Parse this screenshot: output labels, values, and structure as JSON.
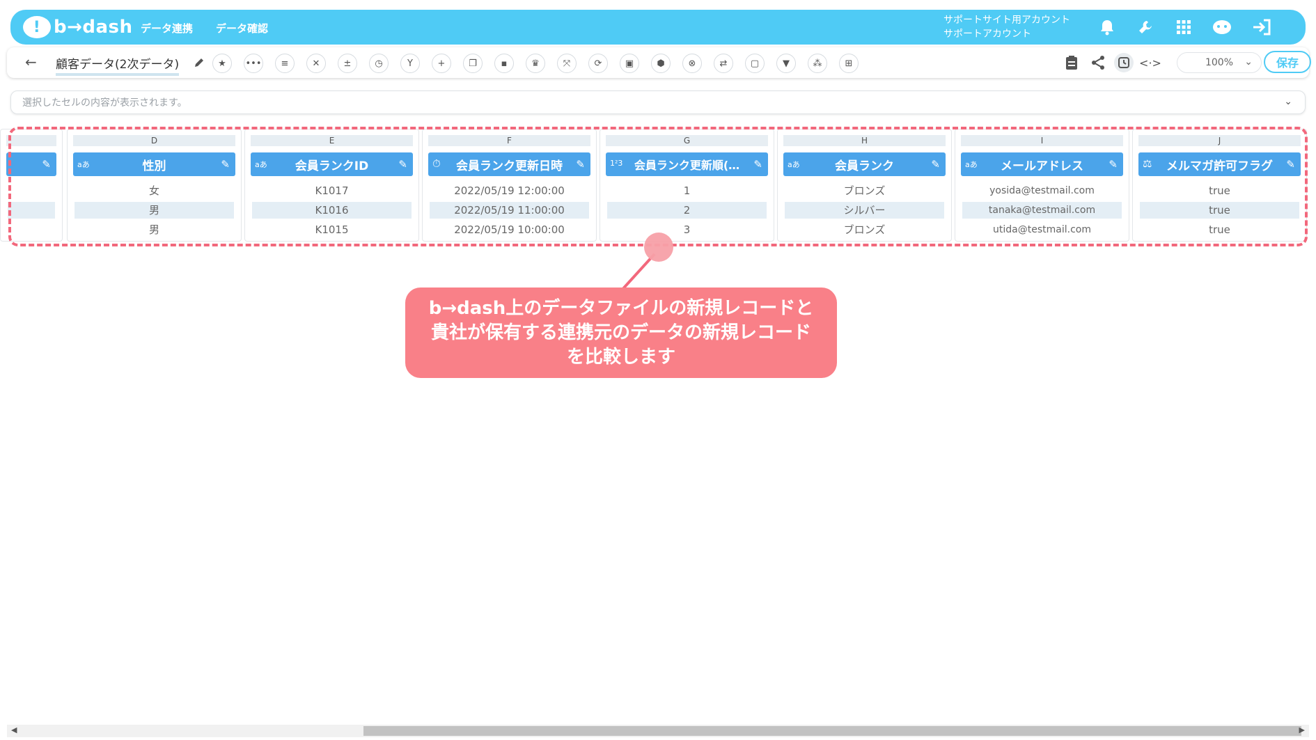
{
  "app": {
    "logo_text": "b→dash",
    "nav": [
      "データ連携",
      "データ確認"
    ],
    "account_line1": "サポートサイト用アカウント",
    "account_line2": "サポートアカウント",
    "top_icons": [
      "bell-icon",
      "wrench-icon",
      "apps-grid-icon",
      "chat-robot-icon",
      "logout-icon"
    ],
    "accent": "#4fcbf5"
  },
  "toolbar": {
    "back": "←",
    "title": "顧客データ(2次データ)",
    "tool_icons": [
      "star-icon",
      "dots-icon",
      "lines-icon",
      "tools-icon",
      "calc-icon",
      "timer-icon",
      "merge-icon",
      "plus-icon",
      "copy-icon",
      "trash-icon",
      "crown-icon",
      "expand-icon",
      "repeat-icon",
      "lock-icon",
      "box-icon",
      "cancel-icon",
      "replace-icon",
      "frame-icon",
      "filter-icon",
      "pattern-icon",
      "table-icon"
    ],
    "right_icons": [
      "clipboard-icon",
      "share-icon",
      "history-icon",
      "code-icon"
    ],
    "zoom": "100%",
    "save_label": "保存"
  },
  "cellbar": {
    "placeholder": "選択したセルの内容が表示されます。"
  },
  "columns": [
    {
      "letter": "",
      "name": "",
      "type": "",
      "cells": [
        "",
        "",
        ""
      ]
    },
    {
      "letter": "D",
      "name": "性別",
      "type": "aあ",
      "cells": [
        "女",
        "男",
        "男"
      ]
    },
    {
      "letter": "E",
      "name": "会員ランクID",
      "type": "aあ",
      "cells": [
        "K1017",
        "K1016",
        "K1015"
      ]
    },
    {
      "letter": "F",
      "name": "会員ランク更新日時",
      "type": "⏱",
      "cells": [
        "2022/05/19 12:00:00",
        "2022/05/19 11:00:00",
        "2022/05/19 10:00:00"
      ]
    },
    {
      "letter": "G",
      "name": "会員ランク更新順(…",
      "type": "1²3",
      "cells": [
        "1",
        "2",
        "3"
      ]
    },
    {
      "letter": "H",
      "name": "会員ランク",
      "type": "aあ",
      "cells": [
        "ブロンズ",
        "シルバー",
        "ブロンズ"
      ]
    },
    {
      "letter": "I",
      "name": "メールアドレス",
      "type": "aあ",
      "cells": [
        "yosida@testmail.com",
        "tanaka@testmail.com",
        "utida@testmail.com"
      ]
    },
    {
      "letter": "J",
      "name": "メルマガ許可フラグ",
      "type": "⚖",
      "cells": [
        "true",
        "true",
        "true"
      ]
    }
  ],
  "callout": {
    "text": "b→dash上のデータファイルの新規レコードと\n貴社が保有する連携元のデータの新規レコード\nを比較します",
    "color": "#f98088",
    "border_color": "#f2687c"
  }
}
